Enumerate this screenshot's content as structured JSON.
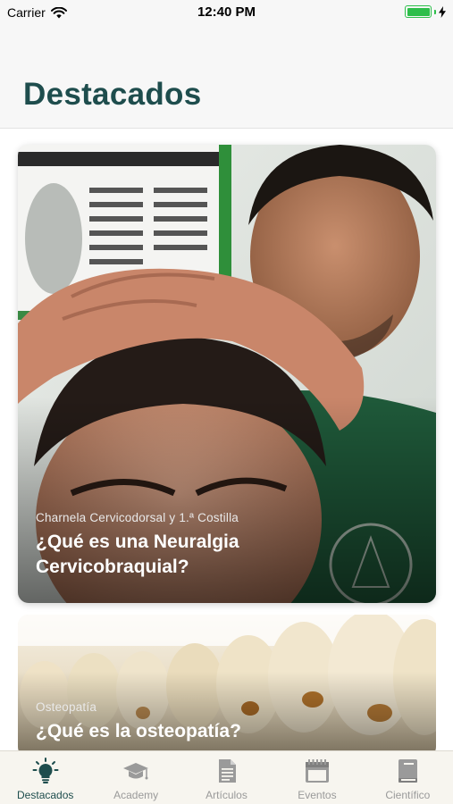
{
  "status_bar": {
    "carrier": "Carrier",
    "time": "12:40 PM",
    "battery_level": 1.0
  },
  "header": {
    "title": "Destacados"
  },
  "cards": [
    {
      "category": "Charnela Cervicodorsal y 1.ª Costilla",
      "title": "¿Qué es una Neuralgia Cervicobraquial?"
    },
    {
      "category": "Osteopatía",
      "title": "¿Qué es la osteopatía?"
    }
  ],
  "tabs": [
    {
      "label": "Destacados",
      "icon": "lightbulb-icon",
      "active": true
    },
    {
      "label": "Academy",
      "icon": "graduation-cap-icon",
      "active": false
    },
    {
      "label": "Artículos",
      "icon": "document-icon",
      "active": false
    },
    {
      "label": "Eventos",
      "icon": "calendar-icon",
      "active": false
    },
    {
      "label": "Científico",
      "icon": "book-icon",
      "active": false
    }
  ],
  "colors": {
    "accent": "#1e4d4d",
    "tab_inactive": "#9a9a9a",
    "battery": "#2dbe4a"
  }
}
